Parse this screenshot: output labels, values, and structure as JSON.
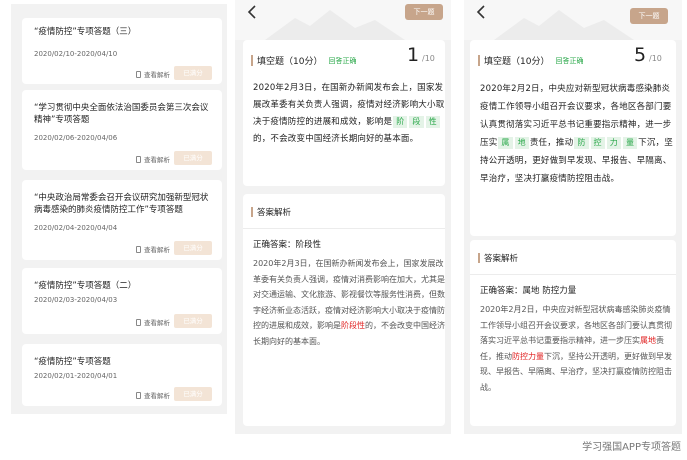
{
  "list": {
    "view_label": "查看解析",
    "btn_label": "已满分",
    "items": [
      {
        "title": "“疫情防控”专项答题（三）",
        "date": "2020/02/10-2020/04/10"
      },
      {
        "title": "“学习贯彻中央全面依法治国委员会第三次会议精神”专项答题",
        "date": "2020/02/06-2020/04/06"
      },
      {
        "title": "“中央政治局常委会召开会议研究加强新型冠状病毒感染的肺炎疫情防控工作”专项答题",
        "date": "2020/02/04-2020/04/04"
      },
      {
        "title": "“疫情防控”专项答题（二）",
        "date": "2020/02/03-2020/04/03"
      },
      {
        "title": "“疫情防控”专项答题",
        "date": "2020/02/01-2020/04/01"
      }
    ]
  },
  "mid": {
    "next_btn": "下一题",
    "q_type": "填空题（10分）",
    "q_status": "回答正确",
    "q_num": "1",
    "q_total": "/10",
    "q_text_1": "2020年2月3日，在国新办新闻发布会上，国家发展改革委有关负责人强调，疫情对经济影响大小取决于疫情防控的进展和成效，影响是",
    "chips": [
      "阶",
      "段",
      "性"
    ],
    "q_text_2": "的，不会改变中国经济长期向好的基本面。",
    "a_title": "答案解析",
    "correct_label": "正确答案：",
    "correct_value": "阶段性",
    "expl_1": "2020年2月3日，在国新办新闻发布会上，国家发展改革委有关负责人强调，疫情对消费影响在加大，尤其是对交通运输、文化旅游、影视餐饮等服务性消费，但数字经济新业态活跃，疫情对经济影响大小取决于疫情防控的进展和成效，影响是",
    "expl_hl": "阶段性",
    "expl_2": "的，不会改变中国经济长期向好的基本面。"
  },
  "right": {
    "next_btn": "下一题",
    "q_type": "填空题（10分）",
    "q_status": "回答正确",
    "q_num": "5",
    "q_total": "/10",
    "q_text_1": "2020年2月2日，中央应对新型冠状病毒感染肺炎疫情工作领导小组召开会议要求，各地区各部门要认真贯彻落实习近平总书记重要指示精神，进一步压实",
    "chips_a": [
      "属",
      "地"
    ],
    "q_text_2": "责任，推动",
    "chips_b": [
      "防",
      "控",
      "力",
      "量"
    ],
    "q_text_3": "下沉，坚持公开透明，更好做到早发现、早报告、早隔离、早治疗，坚决打赢疫情防控阻击战。",
    "a_title": "答案解析",
    "correct_label": "正确答案：",
    "correct_value": "属地 防控力量",
    "expl_1": "2020年2月2日，中央应对新型冠状病毒感染肺炎疫情工作领导小组召开会议要求，各地区各部门要认真贯彻落实习近平总书记重要指示精神，进一步压实",
    "expl_hl_1": "属地",
    "expl_2": "责任，推动",
    "expl_hl_2": "防控力量",
    "expl_3": "下沉，坚持公开透明，更好做到早发现、早报告、早隔离、早治疗，坚决打赢疫情防控阻击战。"
  },
  "footer": "学习强国APP专项答题"
}
